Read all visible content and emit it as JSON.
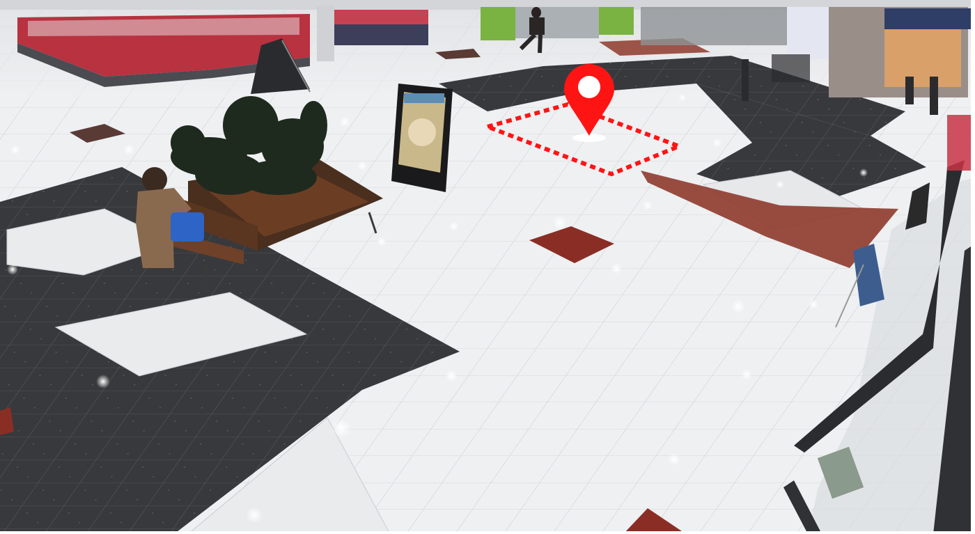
{
  "scene": {
    "floor_light": "#eceff1",
    "floor_dark": "#3a3b3e",
    "floor_red": "#8a2e25",
    "accent_marker": "#ff1414"
  },
  "overlay": {
    "marker_icon": "map-pin-icon",
    "zone_style": "dashed-polygon"
  }
}
